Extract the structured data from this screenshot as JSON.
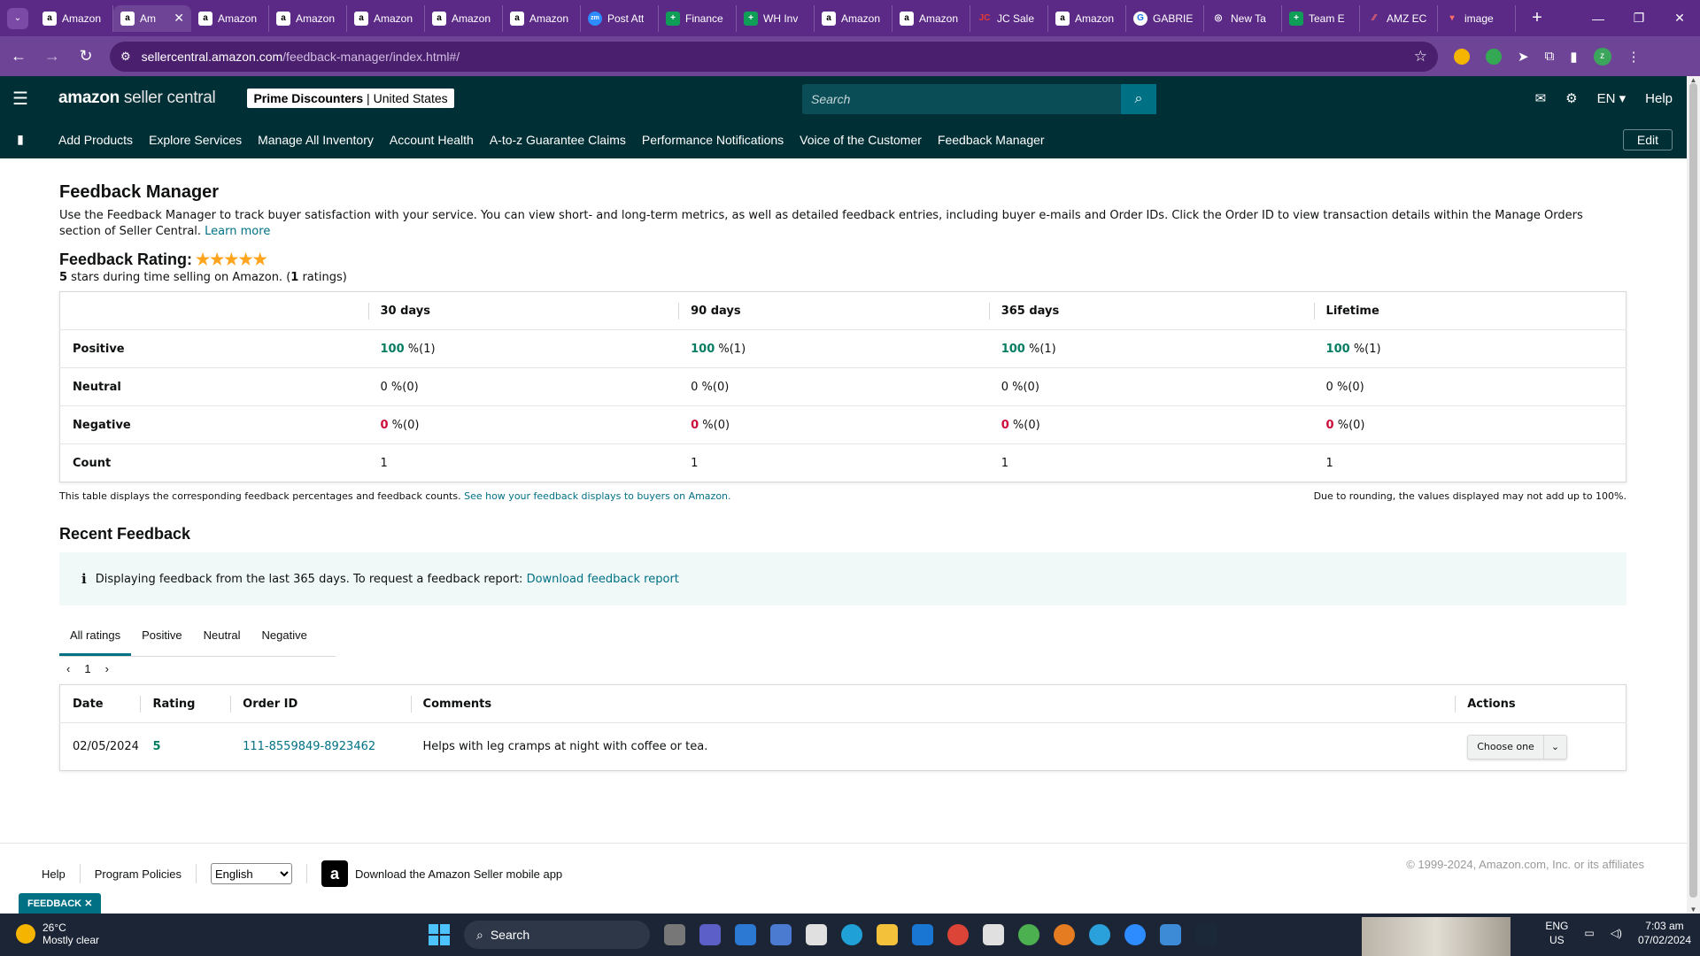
{
  "browser": {
    "tabs": [
      {
        "title": "Amazon",
        "icon": "amazon-icon",
        "active": false
      },
      {
        "title": "Am",
        "icon": "amazon-icon",
        "active": true
      },
      {
        "title": "Amazon",
        "icon": "amazon-icon",
        "active": false
      },
      {
        "title": "Amazon",
        "icon": "amazon-icon",
        "active": false
      },
      {
        "title": "Amazon",
        "icon": "amazon-icon",
        "active": false
      },
      {
        "title": "Amazon",
        "icon": "amazon-icon",
        "active": false
      },
      {
        "title": "Amazon",
        "icon": "amazon-icon",
        "active": false
      },
      {
        "title": "Post Att",
        "icon": "zoom-icon",
        "active": false
      },
      {
        "title": "Finance",
        "icon": "sheets-icon",
        "active": false
      },
      {
        "title": "WH Inv",
        "icon": "sheets-icon",
        "active": false
      },
      {
        "title": "Amazon",
        "icon": "amazon-icon",
        "active": false
      },
      {
        "title": "Amazon",
        "icon": "amazon-icon",
        "active": false
      },
      {
        "title": "JC Sale",
        "icon": "jc-icon",
        "active": false
      },
      {
        "title": "Amazon",
        "icon": "amazon-icon",
        "active": false
      },
      {
        "title": "GABRIE",
        "icon": "google-icon",
        "active": false
      },
      {
        "title": "New Ta",
        "icon": "chrome-icon",
        "active": false
      },
      {
        "title": "Team E",
        "icon": "sheets-icon",
        "active": false
      },
      {
        "title": "AMZ EC",
        "icon": "colorful-icon",
        "active": false
      },
      {
        "title": "image",
        "icon": "image-icon",
        "active": false
      }
    ],
    "url_domain": "sellercentral.amazon.com",
    "url_path": "/feedback-manager/index.html#/",
    "profile_initial": "z"
  },
  "header": {
    "logo_bold": "amazon",
    "logo_rest": " seller central",
    "store_name": "Prime Discounters",
    "store_sep": " | ",
    "store_region": "United States",
    "search_placeholder": "Search",
    "language": "EN",
    "help": "Help"
  },
  "nav": {
    "links": [
      "Add Products",
      "Explore Services",
      "Manage All Inventory",
      "Account Health",
      "A-to-z Guarantee Claims",
      "Performance Notifications",
      "Voice of the Customer",
      "Feedback Manager"
    ],
    "edit": "Edit"
  },
  "page": {
    "title": "Feedback Manager",
    "intro": "Use the Feedback Manager to track buyer satisfaction with your service. You can view short- and long-term metrics, as well as detailed feedback entries, including buyer e-mails and Order IDs. Click the Order ID to view transaction details within the Manage Orders section of Seller Central.",
    "learn_more": "Learn more",
    "rating_label": "Feedback Rating:",
    "stars": "★★★★★",
    "rating_stars_num": "5",
    "rating_sub_mid": " stars during time selling on Amazon. (",
    "rating_count": "1",
    "rating_sub_end": " ratings)"
  },
  "metrics": {
    "columns": [
      "30 days",
      "90 days",
      "365 days",
      "Lifetime"
    ],
    "rows": [
      {
        "label": "Positive",
        "cells": [
          {
            "num": "100",
            "rest": " %(1)"
          },
          {
            "num": "100",
            "rest": " %(1)"
          },
          {
            "num": "100",
            "rest": " %(1)"
          },
          {
            "num": "100",
            "rest": " %(1)"
          }
        ]
      },
      {
        "label": "Neutral",
        "cells": [
          {
            "num": "0",
            "rest": " %(0)"
          },
          {
            "num": "0",
            "rest": " %(0)"
          },
          {
            "num": "0",
            "rest": " %(0)"
          },
          {
            "num": "0",
            "rest": " %(0)"
          }
        ]
      },
      {
        "label": "Negative",
        "cells": [
          {
            "num": "0",
            "rest": " %(0)"
          },
          {
            "num": "0",
            "rest": " %(0)"
          },
          {
            "num": "0",
            "rest": " %(0)"
          },
          {
            "num": "0",
            "rest": " %(0)"
          }
        ]
      },
      {
        "label": "Count",
        "cells": [
          {
            "num": "",
            "rest": "1"
          },
          {
            "num": "",
            "rest": "1"
          },
          {
            "num": "",
            "rest": "1"
          },
          {
            "num": "",
            "rest": "1"
          }
        ]
      }
    ],
    "note_left": "This table displays the corresponding feedback percentages and feedback counts.",
    "note_link": "See how your feedback displays to buyers on Amazon.",
    "note_right": "Due to rounding, the values displayed may not add up to 100%."
  },
  "recent": {
    "title": "Recent Feedback",
    "info_text": "Displaying feedback from the last 365 days. To request a feedback report:",
    "info_link": "Download feedback report",
    "tabs": [
      "All ratings",
      "Positive",
      "Neutral",
      "Negative"
    ],
    "page": "1",
    "columns": [
      "Date",
      "Rating",
      "Order ID",
      "Comments",
      "Actions"
    ],
    "rows": [
      {
        "date": "02/05/2024",
        "rating": "5",
        "order_id": "111-8559849-8923462",
        "comment": "Helps with leg cramps at night with coffee or tea.",
        "action": "Choose one"
      }
    ]
  },
  "footer": {
    "help": "Help",
    "policies": "Program Policies",
    "language": "English",
    "app_text": "Download the Amazon Seller mobile app",
    "copyright": "© 1999-2024, Amazon.com, Inc. or its affiliates",
    "feedback_tab": "FEEDBACK"
  },
  "taskbar": {
    "temp": "26°C",
    "weather": "Mostly clear",
    "search": "Search",
    "lang1": "ENG",
    "lang2": "US",
    "time": "7:03 am",
    "date": "07/02/2024"
  },
  "colors": {
    "header_bg": "#002f36",
    "link": "#007185",
    "positive": "#067d62",
    "negative": "#cc0c39",
    "tabbar": "#5b2a86"
  }
}
